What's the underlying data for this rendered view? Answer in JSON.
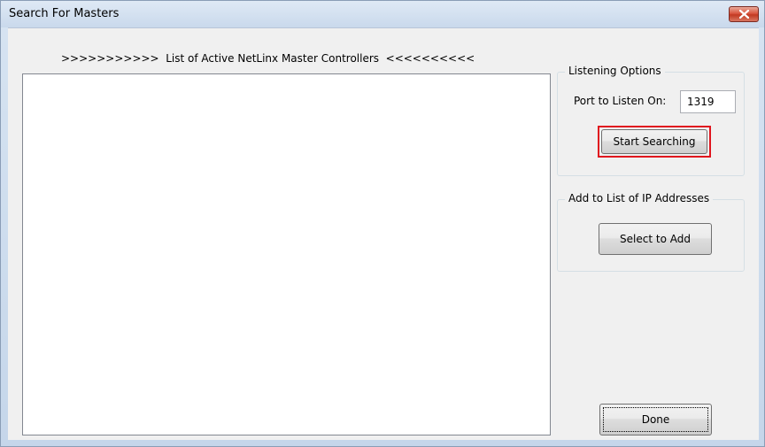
{
  "window": {
    "title": "Search For Masters"
  },
  "list": {
    "header": ">>>>>>>>>>>  List of Active NetLinx Master Controllers  <<<<<<<<<<",
    "items": []
  },
  "listening_options": {
    "legend": "Listening Options",
    "port_label": "Port to Listen On:",
    "port_value": "1319",
    "start_button": "Start Searching"
  },
  "add_ip": {
    "legend": "Add to List of IP Addresses",
    "select_button": "Select to Add"
  },
  "footer": {
    "done_button": "Done"
  },
  "colors": {
    "highlight": "#e0151e",
    "close_button": "#c23a22"
  },
  "icons": {
    "close": "close-icon"
  }
}
